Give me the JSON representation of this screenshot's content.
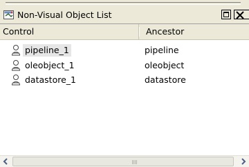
{
  "window": {
    "title": "Non-Visual Object List"
  },
  "columns": {
    "control": "Control",
    "ancestor": "Ancestor"
  },
  "rows": [
    {
      "name": "pipeline_1",
      "ancestor": "pipeline",
      "selected": true
    },
    {
      "name": "oleobject_1",
      "ancestor": "oleobject",
      "selected": false
    },
    {
      "name": "datastore_1",
      "ancestor": "datastore",
      "selected": false
    }
  ],
  "icons": {
    "title": "object-list-icon",
    "row": "non-visual-object-icon",
    "maximize": "maximize-icon",
    "close": "close-icon",
    "scroll_left": "chevron-left-icon",
    "scroll_right": "chevron-right-icon"
  },
  "colors": {
    "panel_bg": "#ece9d8",
    "list_bg": "#ffffff",
    "selection_bg": "#e6e6e6"
  }
}
